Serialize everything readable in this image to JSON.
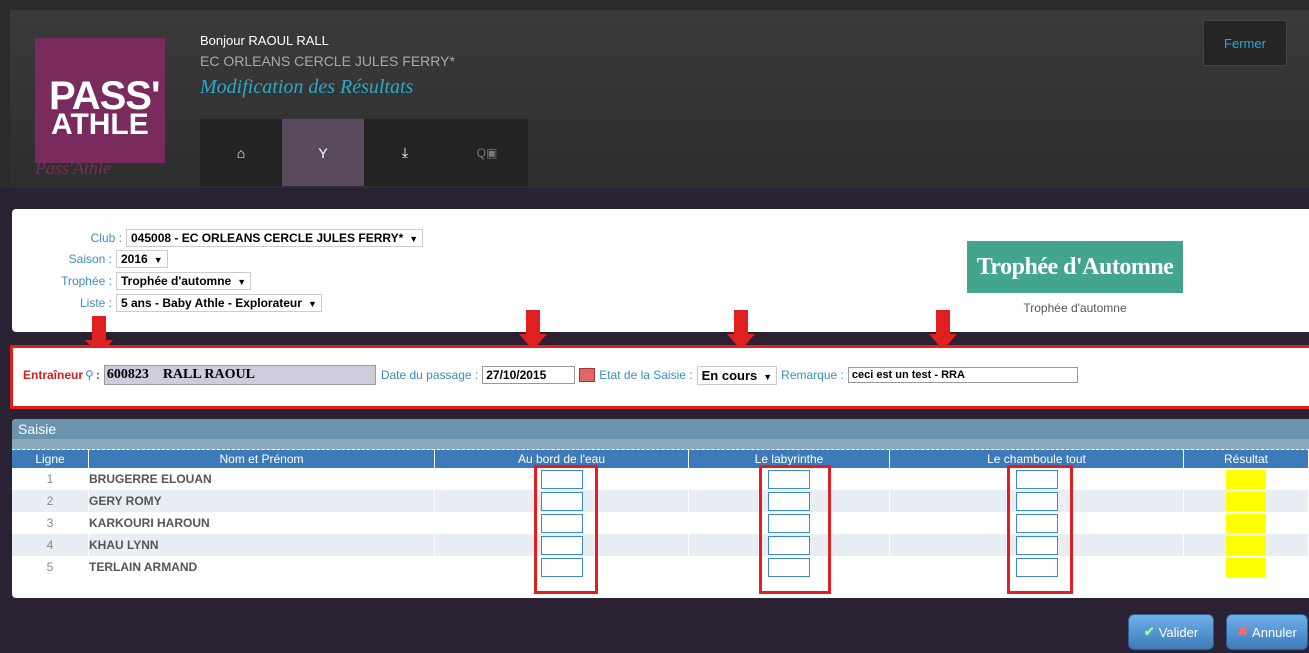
{
  "header": {
    "greeting": "Bonjour RAOUL RALL",
    "club": "EC ORLEANS CERCLE JULES FERRY*",
    "title": "Modification des Résultats",
    "close_label": "Fermer",
    "logo": {
      "line1": "PASS'",
      "line2": "ATHLE",
      "subtitle": "Pass'Athle"
    },
    "nav": [
      {
        "icon": "home-icon",
        "glyph": "⌂"
      },
      {
        "icon": "trophy-icon",
        "glyph": "🏆"
      },
      {
        "icon": "download-icon",
        "glyph": "⤓"
      },
      {
        "icon": "search-icon",
        "glyph": "🔍"
      }
    ]
  },
  "filters": {
    "club_label": "Club :",
    "club_value": "045008 - EC ORLEANS CERCLE JULES FERRY*",
    "saison_label": "Saison :",
    "saison_value": "2016",
    "trophee_label": "Trophée :",
    "trophee_value": "Trophée d'automne",
    "liste_label": "Liste :",
    "liste_value": "5 ans - Baby Athle - Explorateur",
    "trophy_banner": "Trophée d'Automne",
    "trophy_caption": "Trophée d'automne"
  },
  "session": {
    "coach_label": "Entraîneur",
    "coach_id": "600823",
    "coach_name": "RALL RAOUL",
    "date_label": "Date du passage :",
    "date_value": "27/10/2015",
    "etat_label": "Etat de la Saisie :",
    "etat_value": "En cours",
    "remarque_label": "Remarque :",
    "remarque_value": "ceci est un test - RRA"
  },
  "saisie": {
    "title": "Saisie",
    "columns": [
      "Ligne",
      "Nom et Prénom",
      "Au bord de l'eau",
      "Le labyrinthe",
      "Le chamboule tout",
      "Résultat"
    ],
    "rows": [
      {
        "ligne": "1",
        "nom": "BRUGERRE ELOUAN"
      },
      {
        "ligne": "2",
        "nom": "GERY ROMY"
      },
      {
        "ligne": "3",
        "nom": "KARKOURI HAROUN"
      },
      {
        "ligne": "4",
        "nom": "KHAU LYNN"
      },
      {
        "ligne": "5",
        "nom": "TERLAIN ARMAND"
      }
    ]
  },
  "actions": {
    "valider": "Valider",
    "annuler": "Annuler"
  },
  "colors": {
    "accent": "#3d7ab9",
    "highlight": "#e02020",
    "brand": "#7a2b5e"
  }
}
